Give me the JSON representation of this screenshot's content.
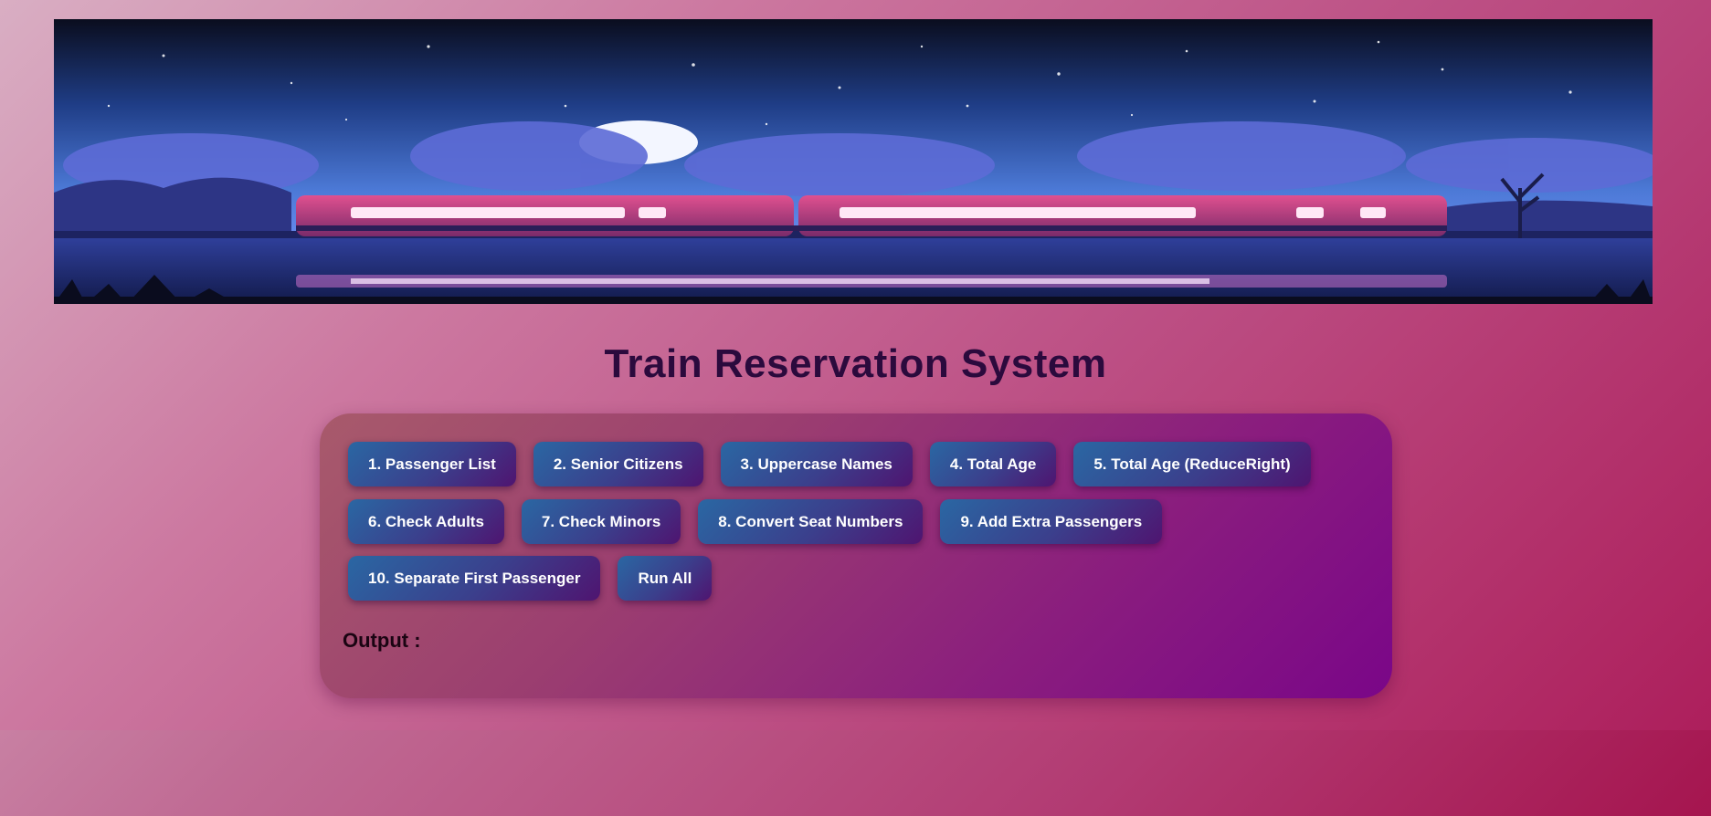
{
  "header": {
    "title": "Train Reservation System"
  },
  "banner": {
    "image": "night-train-illustration"
  },
  "buttons": {
    "row1": [
      "1. Passenger List",
      "2. Senior Citizens",
      "3. Uppercase Names",
      "4. Total Age",
      "5. Total Age (ReduceRight)"
    ],
    "row2": [
      "6. Check Adults",
      "7. Check Minors",
      "8. Convert Seat Numbers",
      "9. Add Extra Passengers"
    ],
    "row3": [
      "10. Separate First Passenger",
      "Run All"
    ]
  },
  "output": {
    "label": "Output :"
  },
  "colors": {
    "title": "#2b0a3d",
    "button_start": "#2a67a3",
    "button_end": "#4f1470",
    "panel_end": "#7a0688"
  }
}
